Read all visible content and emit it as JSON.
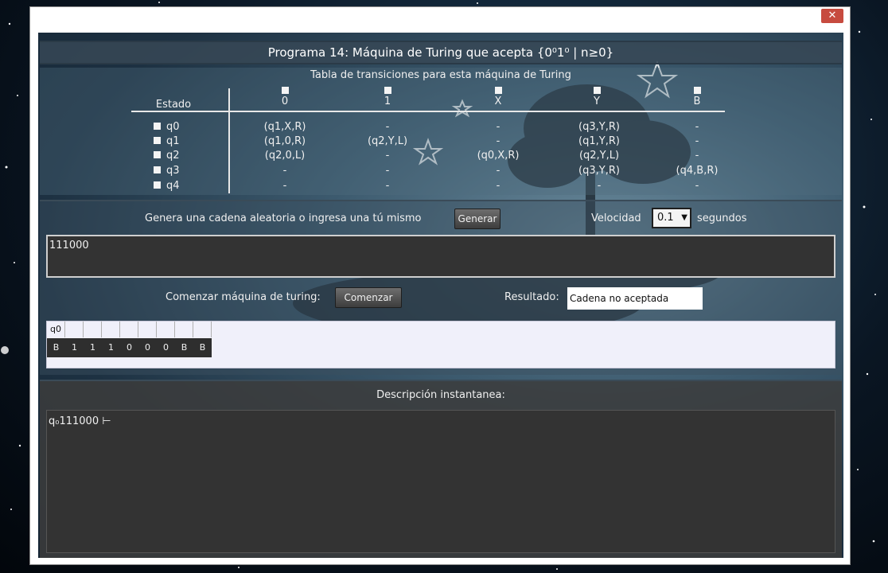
{
  "window": {
    "title": "Programa 14: Máquina de Turing   que acepta {0⁰1⁰ | n≥0}",
    "close_glyph": "✕"
  },
  "transition_table": {
    "title": "Tabla de transiciones para esta máquina de Turing",
    "state_header": "Estado",
    "symbols": [
      "0",
      "1",
      "X",
      "Y",
      "B"
    ],
    "states": [
      "q0",
      "q1",
      "q2",
      "q3",
      "q4"
    ],
    "rows": [
      [
        "(q1,X,R)",
        "-",
        "-",
        "(q3,Y,R)",
        "-"
      ],
      [
        "(q1,0,R)",
        "(q2,Y,L)",
        "-",
        "(q1,Y,R)",
        "-"
      ],
      [
        "(q2,0,L)",
        "-",
        "(q0,X,R)",
        "(q2,Y,L)",
        "-"
      ],
      [
        "-",
        "-",
        "-",
        "(q3,Y,R)",
        "(q4,B,R)"
      ],
      [
        "-",
        "-",
        "-",
        "-",
        "-"
      ]
    ]
  },
  "generator": {
    "label": "Genera una cadena aleatoria o ingresa una tú mismo",
    "button": "Generar",
    "speed_label": "Velocidad",
    "speed_value": "0.1",
    "speed_unit": "segundos",
    "input_value": "111000"
  },
  "runner": {
    "label": "Comenzar máquina de turing:",
    "button": "Comenzar",
    "result_label": "Resultado:",
    "result_value": "Cadena no aceptada"
  },
  "tape": {
    "state_cells": [
      "q0",
      "",
      "",
      "",
      "",
      "",
      "",
      "",
      "",
      ""
    ],
    "cells": [
      "B",
      "1",
      "1",
      "1",
      "0",
      "0",
      "0",
      "B",
      "B"
    ]
  },
  "description": {
    "label": "Descripción instantanea:",
    "content": "q₀111000 ⊢"
  },
  "colors": {
    "panel_dark": "#333333",
    "text": "#f0f0f0"
  }
}
